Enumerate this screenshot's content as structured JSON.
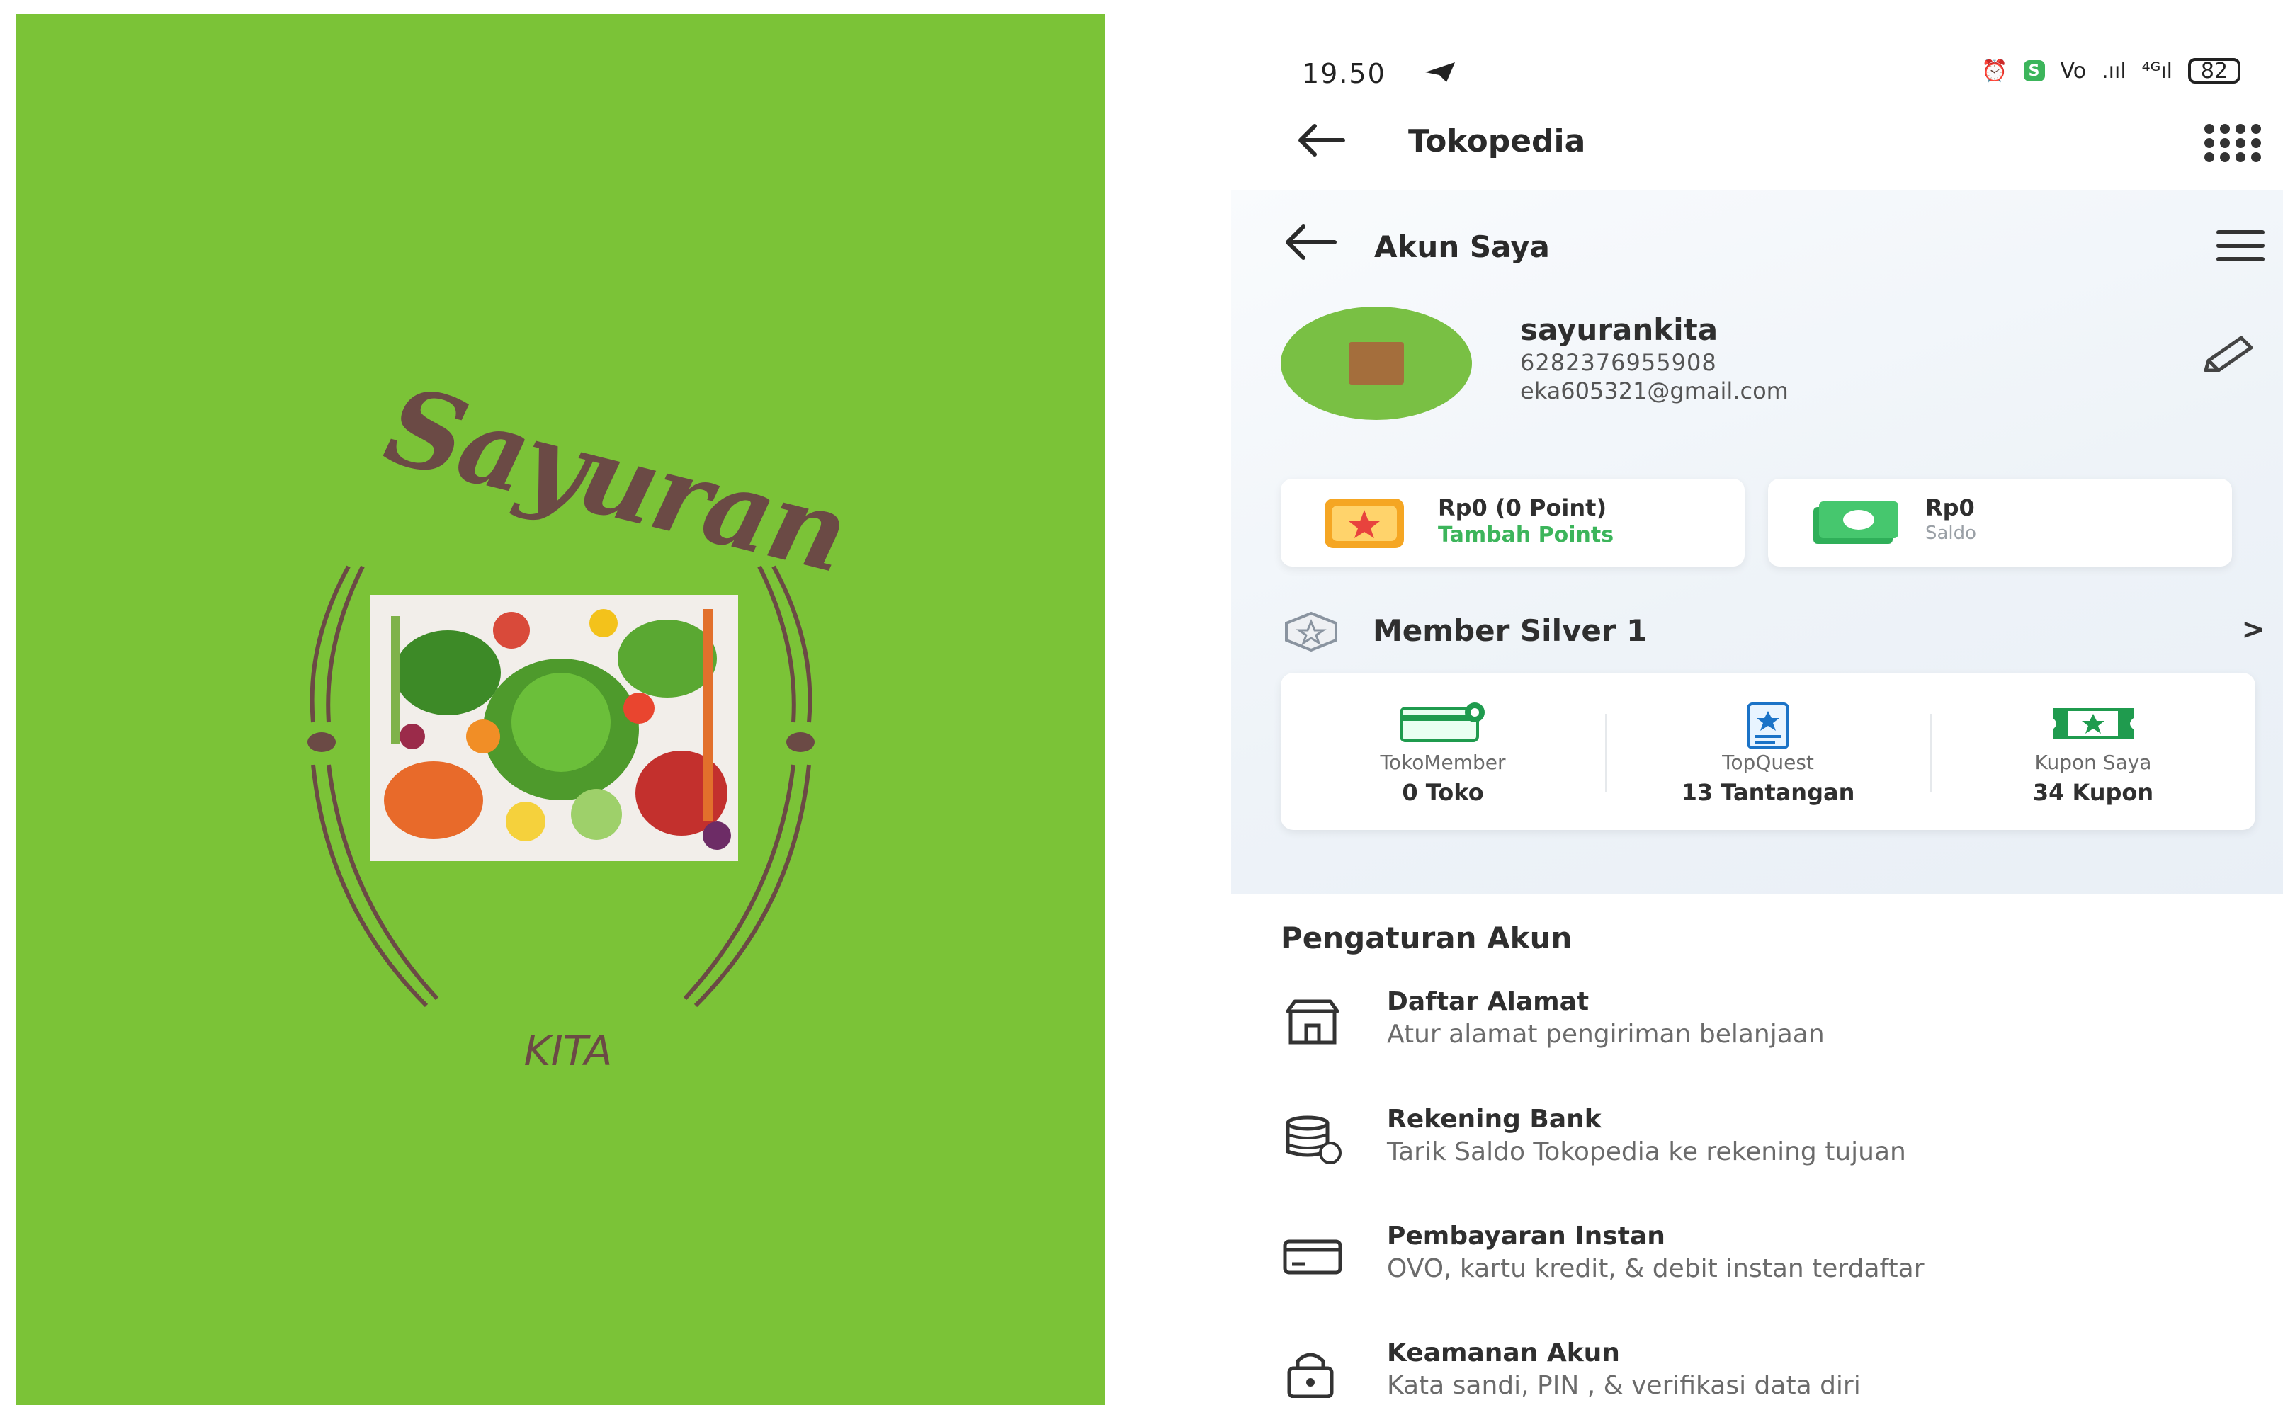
{
  "splash": {
    "title": "Sayuran",
    "subtitle": "KITA",
    "background_color": "#7bc337",
    "text_color": "#6b4a45"
  },
  "phone": {
    "status_bar": {
      "time": "19.50",
      "battery": "82"
    },
    "app_bar": {
      "title": "Tokopedia"
    },
    "account_page": {
      "title": "Akun Saya",
      "profile": {
        "name": "sayurankita",
        "phone": "6282376955908",
        "email": "eka605321@gmail.com"
      },
      "points_card": {
        "value": "Rp0 (0 Point)",
        "action": "Tambah Points"
      },
      "saldo_card": {
        "value": "Rp0",
        "label": "Saldo"
      },
      "member": {
        "title": "Member Silver 1"
      },
      "stats": [
        {
          "label": "TokoMember",
          "value": "0 Toko"
        },
        {
          "label": "TopQuest",
          "value": "13 Tantangan"
        },
        {
          "label": "Kupon Saya",
          "value": "34 Kupon"
        }
      ]
    },
    "settings": {
      "title": "Pengaturan Akun",
      "items": [
        {
          "title": "Daftar Alamat",
          "desc": "Atur alamat pengiriman belanjaan",
          "icon": "store-icon"
        },
        {
          "title": "Rekening Bank",
          "desc": "Tarik Saldo Tokopedia ke rekening tujuan",
          "icon": "bank-icon"
        },
        {
          "title": "Pembayaran Instan",
          "desc": "OVO, kartu kredit, & debit instan terdaftar",
          "icon": "card-icon"
        },
        {
          "title": "Keamanan Akun",
          "desc": "Kata sandi, PIN , & verifikasi data diri",
          "icon": "lock-icon"
        }
      ]
    },
    "accent_color": "#3cb55b"
  }
}
